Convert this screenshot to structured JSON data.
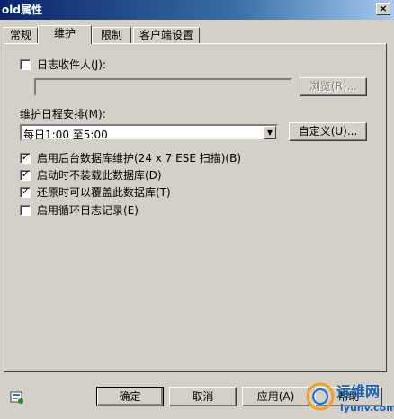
{
  "window": {
    "title": "old属性",
    "close_glyph": "×"
  },
  "tabs": [
    {
      "label": "常规"
    },
    {
      "label": "维护"
    },
    {
      "label": "限制"
    },
    {
      "label": "客户端设置"
    }
  ],
  "journal": {
    "label": "日志收件人(J):",
    "checked": false,
    "recipient_value": "",
    "browse_label": "浏览(R)..."
  },
  "schedule": {
    "label": "维护日程安排(M):",
    "selected": "每日1:00 至5:00",
    "customize_label": "自定义(U)..."
  },
  "options": [
    {
      "label": "启用后台数据库维护(24 x 7 ESE 扫描)(B)",
      "checked": true
    },
    {
      "label": "启动时不装载此数据库(D)",
      "checked": true
    },
    {
      "label": "还原时可以覆盖此数据库(T)",
      "checked": true
    },
    {
      "label": "启用循环日志记录(E)",
      "checked": false
    }
  ],
  "footer": {
    "ok_label": "确定",
    "cancel_label": "取消",
    "apply_label": "应用(A)",
    "help_label": "帮助"
  },
  "watermark": {
    "text": "运维网",
    "url": "iyunv.com"
  }
}
